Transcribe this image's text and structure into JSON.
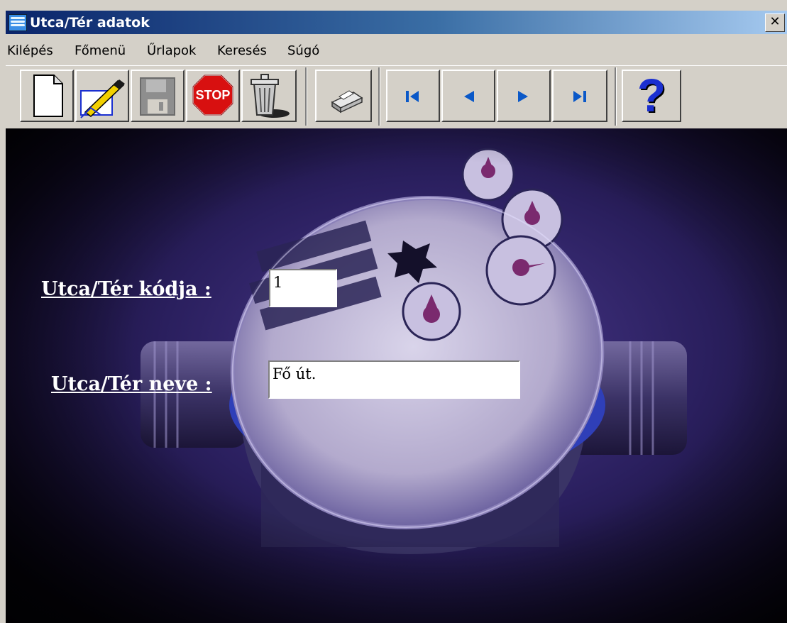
{
  "window": {
    "title": "Utca/Tér adatok",
    "close_glyph": "✕"
  },
  "menu": [
    "Kilépés",
    "Főmenü",
    "Űrlapok",
    "Keresés",
    "Súgó"
  ],
  "toolbar": {
    "stop_label": "STOP",
    "help_label": "?"
  },
  "form": {
    "code_label": "Utca/Tér kódja :",
    "code_value": "1",
    "name_label": "Utca/Tér neve :",
    "name_value": "Fő út."
  },
  "colors": {
    "nav_blue": "#0a58c8",
    "stop_red": "#d81010",
    "help_blue": "#1a2fd0"
  }
}
